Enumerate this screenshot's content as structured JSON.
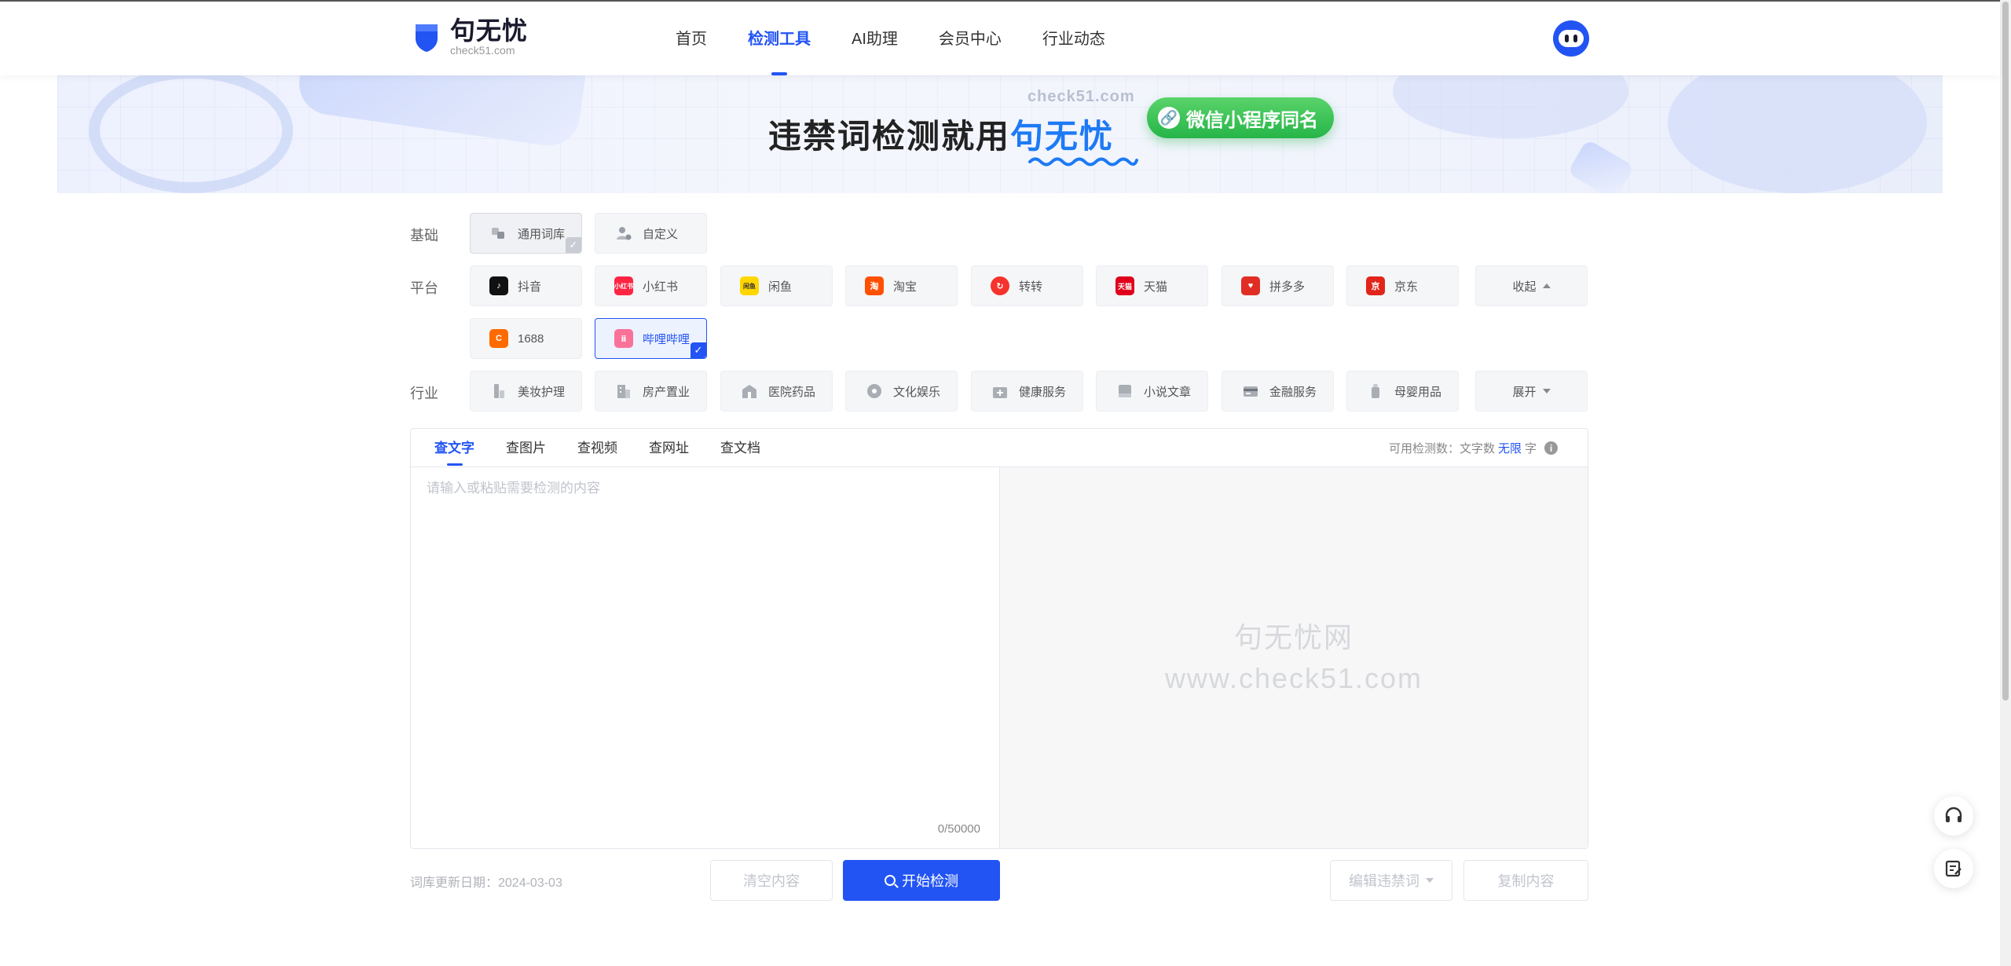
{
  "header": {
    "logo_name": "句无忧",
    "logo_domain": "check51.com",
    "nav": [
      {
        "label": "首页"
      },
      {
        "label": "检测工具"
      },
      {
        "label": "AI助理"
      },
      {
        "label": "会员中心"
      },
      {
        "label": "行业动态"
      }
    ],
    "active_nav": "检测工具"
  },
  "banner": {
    "domain": "check51.com",
    "title_prefix": "违禁词检测就用",
    "title_brand": "句无忧",
    "pill_label": "微信小程序同名"
  },
  "filters": {
    "basic_label": "基础",
    "basic": [
      {
        "label": "通用词库",
        "icon": "book-stack-icon",
        "selected": true
      },
      {
        "label": "自定义",
        "icon": "user-settings-icon",
        "selected": false
      }
    ],
    "platform_label": "平台",
    "platforms": [
      {
        "label": "抖音",
        "icon": "douyin-icon",
        "color": "#111111"
      },
      {
        "label": "小红书",
        "icon": "xiaohongshu-icon",
        "color": "#ff2442"
      },
      {
        "label": "闲鱼",
        "icon": "xianyu-icon",
        "color": "#ffd600"
      },
      {
        "label": "淘宝",
        "icon": "taobao-icon",
        "color": "#ff5000"
      },
      {
        "label": "转转",
        "icon": "zhuanzhuan-icon",
        "color": "#f5332d"
      },
      {
        "label": "天猫",
        "icon": "tmall-icon",
        "color": "#e0001b"
      },
      {
        "label": "拼多多",
        "icon": "pinduoduo-icon",
        "color": "#e02e24"
      },
      {
        "label": "京东",
        "icon": "jd-icon",
        "color": "#e1251b"
      },
      {
        "label": "1688",
        "icon": "1688-icon",
        "color": "#ff6a00"
      },
      {
        "label": "哔哩哔哩",
        "icon": "bilibili-icon",
        "color": "#fb7299",
        "selected": true
      }
    ],
    "platform_toggle": "收起",
    "industry_label": "行业",
    "industries": [
      {
        "label": "美妆护理",
        "icon": "cosmetics-icon"
      },
      {
        "label": "房产置业",
        "icon": "building-icon"
      },
      {
        "label": "医院药品",
        "icon": "hospital-icon"
      },
      {
        "label": "文化娱乐",
        "icon": "culture-icon"
      },
      {
        "label": "健康服务",
        "icon": "medical-kit-icon"
      },
      {
        "label": "小说文章",
        "icon": "novel-icon"
      },
      {
        "label": "金融服务",
        "icon": "card-icon"
      },
      {
        "label": "母婴用品",
        "icon": "baby-bottle-icon"
      }
    ],
    "industry_toggle": "展开"
  },
  "tool": {
    "tabs": [
      {
        "label": "查文字"
      },
      {
        "label": "查图片"
      },
      {
        "label": "查视频"
      },
      {
        "label": "查网址"
      },
      {
        "label": "查文档"
      }
    ],
    "active_tab": "查文字",
    "quota_label": "可用检测数：文字数",
    "quota_value": "无限",
    "quota_unit": "字",
    "input_placeholder": "请输入或粘贴需要检测的内容",
    "input_value": "",
    "counter": "0/50000",
    "watermark_line1": "句无忧网",
    "watermark_line2": "www.check51.com"
  },
  "footer": {
    "updated": "词库更新日期：2024-03-03",
    "clear_label": "清空内容",
    "start_label": "开始检测",
    "edit_label": "编辑违禁词",
    "copy_label": "复制内容"
  },
  "colors": {
    "accent": "#2254f4",
    "wechat_green": "#26b548"
  }
}
